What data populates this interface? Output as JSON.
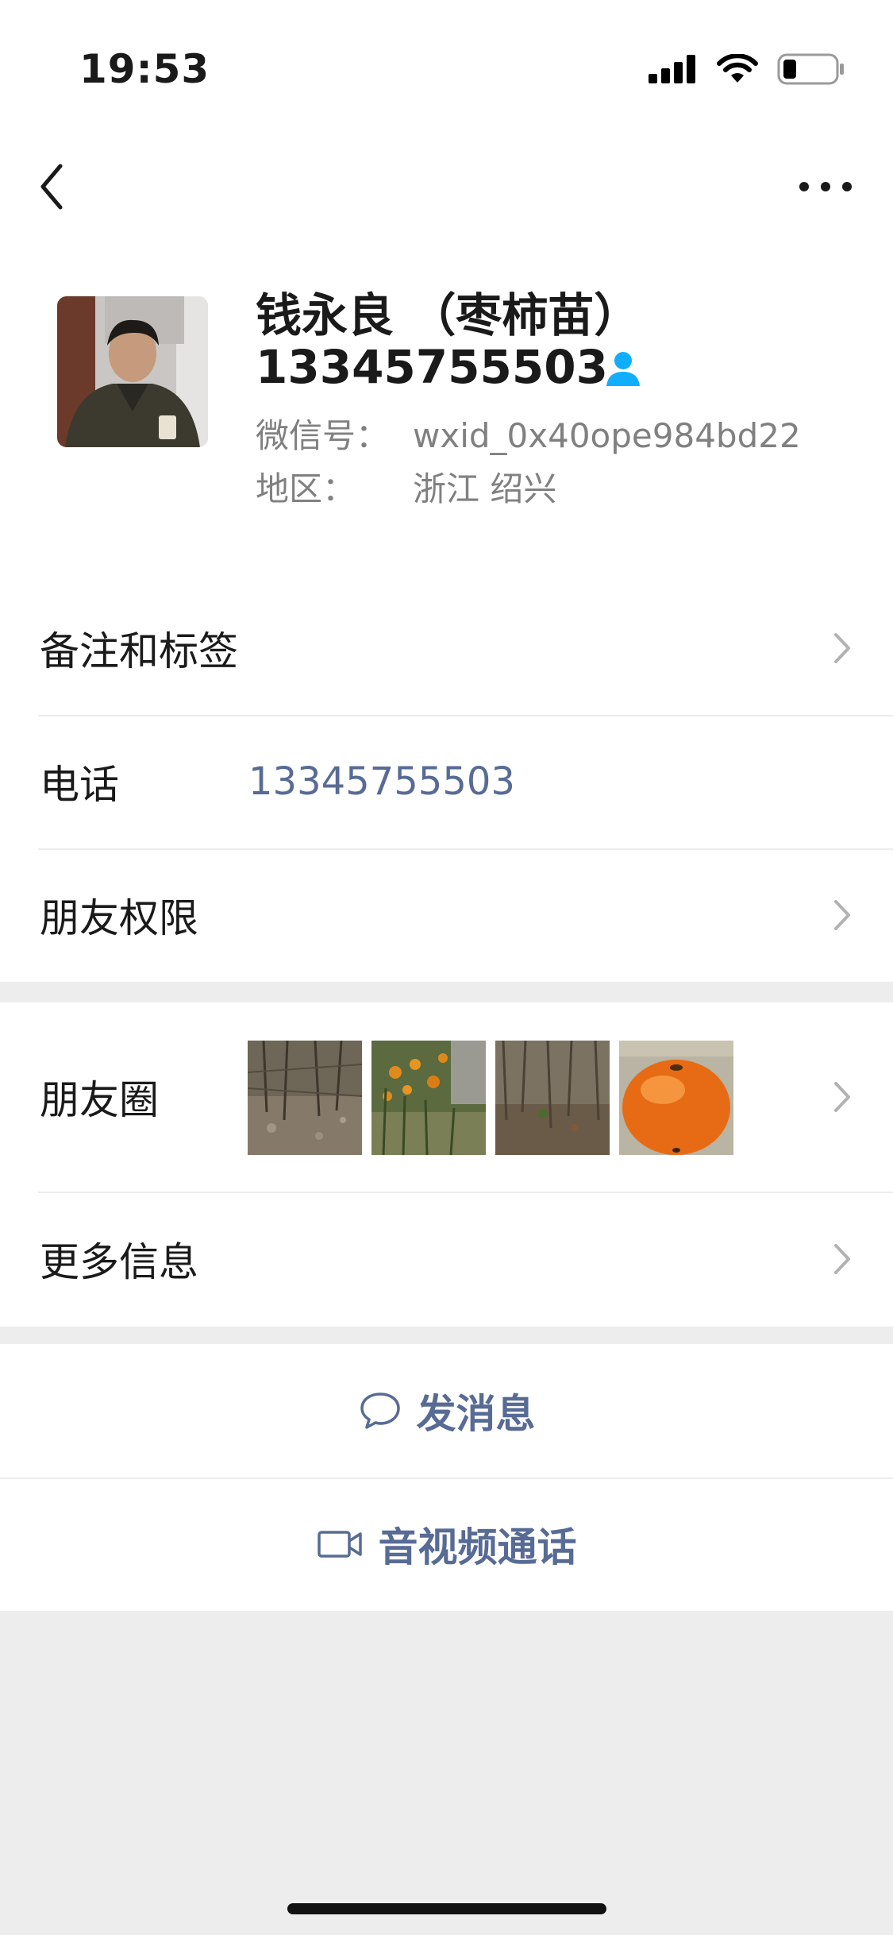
{
  "status_bar": {
    "time": "19:53"
  },
  "profile": {
    "name": "钱永良 （枣柿苗）",
    "display_phone": "13345755503",
    "wechat_id_label": "微信号：",
    "wechat_id": "wxid_0x40ope984bd22",
    "region_label": "地区：",
    "region": "浙江 绍兴"
  },
  "list1": {
    "remarks_label": "备注和标签",
    "phone_label": "电话",
    "phone_value": "13345755503",
    "permissions_label": "朋友权限"
  },
  "list2": {
    "moments_label": "朋友圈",
    "more_info_label": "更多信息"
  },
  "actions": {
    "message_label": "发消息",
    "call_label": "音视频通话"
  },
  "colors": {
    "link": "#576b95",
    "accent_icon": "#10aeff",
    "page_bg": "#ededed"
  }
}
